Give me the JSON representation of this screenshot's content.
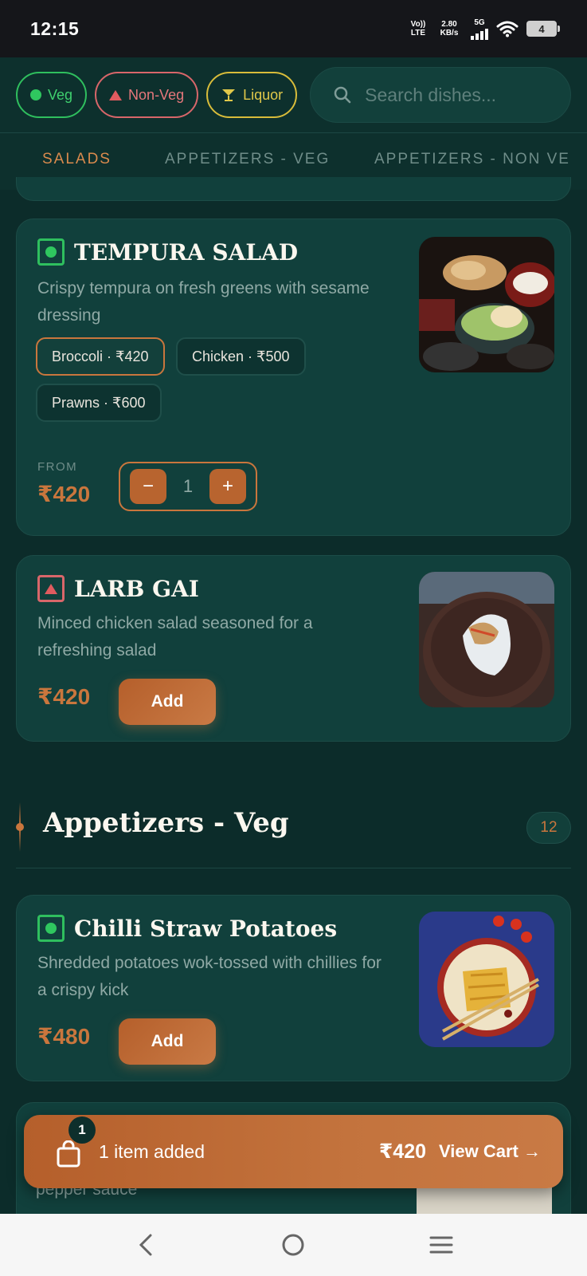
{
  "status": {
    "time": "12:15",
    "net_top": "Vo)) LTE",
    "speed": "2.80 KB/s",
    "signal": "5G",
    "battery": "4"
  },
  "filters": {
    "veg": "Veg",
    "nonveg": "Non-Veg",
    "liquor": "Liquor"
  },
  "search": {
    "placeholder": "Search dishes..."
  },
  "tabs": [
    "SALADS",
    "APPETIZERS - VEG",
    "APPETIZERS - NON VE"
  ],
  "items": [
    {
      "name": "TEMPURA SALAD",
      "desc": "Crispy tempura on fresh greens with sesame dressing",
      "variants": [
        "Broccoli · ₹420",
        "Chicken · ₹500",
        "Prawns · ₹600"
      ],
      "from_label": "FROM",
      "price": "₹420",
      "qty": "1"
    },
    {
      "name": "LARB GAI",
      "desc": "Minced chicken salad seasoned for a refreshing salad",
      "price": "₹420",
      "add": "Add"
    },
    {
      "name": "Chilli Straw Potatoes",
      "desc": "Shredded potatoes wok-tossed with chillies for a crispy kick",
      "price": "₹480",
      "add": "Add"
    }
  ],
  "section": {
    "title": "Appetizers - Veg",
    "count": "12"
  },
  "cart": {
    "badge": "1",
    "text": "1 item added",
    "total": "₹420",
    "link": "View Cart →"
  },
  "peek": {
    "desc": "pepper sauce"
  },
  "colors": {
    "accent": "#c9763d",
    "veg": "#2fbf5e",
    "nonveg": "#e05b5f",
    "liquor": "#d8bc3a",
    "bg": "#0c2c2a"
  }
}
